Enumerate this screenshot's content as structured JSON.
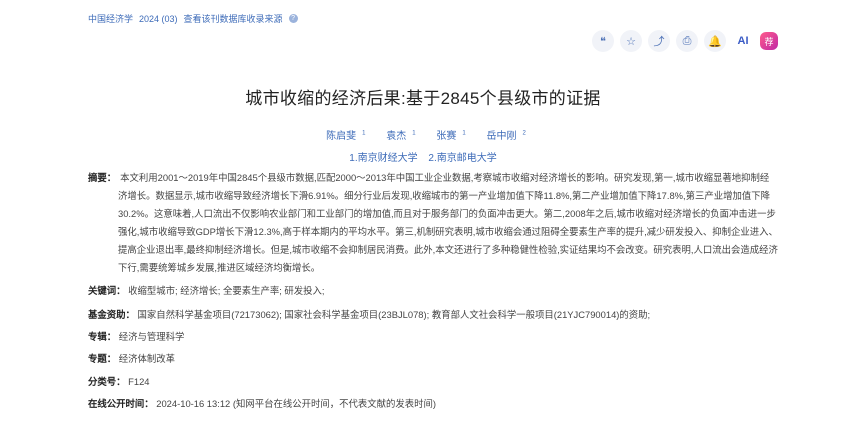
{
  "source": {
    "journal": "中国经济学",
    "issue": "2024 (03)",
    "db_link": "查看该刊数据库收录来源"
  },
  "toolbar": {
    "quote_icon": "quote-icon",
    "star_icon": "star-icon",
    "share_icon": "share-icon",
    "print_icon": "print-icon",
    "bell_icon": "bell-icon",
    "ai_label": "AI",
    "rec_label": "荐"
  },
  "title": "城市收缩的经济后果:基于2845个县级市的证据",
  "authors": [
    {
      "name": "陈启斐",
      "sup": "1"
    },
    {
      "name": "袁杰",
      "sup": "1"
    },
    {
      "name": "张赛",
      "sup": "1"
    },
    {
      "name": "岳中刚",
      "sup": "2"
    }
  ],
  "affiliations": [
    "1.南京财经大学",
    "2.南京邮电大学"
  ],
  "abstract": {
    "label": "摘要：",
    "text": "本文利用2001～2019年中国2845个县级市数据,匹配2000～2013年中国工业企业数据,考察城市收缩对经济增长的影响。研究发现,第一,城市收缩显著地抑制经济增长。数据显示,城市收缩导致经济增长下滑6.91%。细分行业后发现,收缩城市的第一产业增加值下降11.8%,第二产业增加值下降17.8%,第三产业增加值下降30.2%。这意味着,人口流出不仅影响农业部门和工业部门的增加值,而且对于服务部门的负面冲击更大。第二,2008年之后,城市收缩对经济增长的负面冲击进一步强化,城市收缩导致GDP增长下滑12.3%,高于样本期内的平均水平。第三,机制研究表明,城市收缩会通过阻碍全要素生产率的提升,减少研发投入、抑制企业进入、提高企业退出率,最终抑制经济增长。但是,城市收缩不会抑制居民消费。此外,本文还进行了多种稳健性检验,实证结果均不会改变。研究表明,人口流出会造成经济下行,需要统筹城乡发展,推进区域经济均衡增长。"
  },
  "keywords": {
    "label": "关键词：",
    "items": [
      "收缩型城市;",
      "经济增长;",
      "全要素生产率;",
      "研发投入;"
    ]
  },
  "funding": {
    "label": "基金资助：",
    "items": [
      "国家自然科学基金项目(72173062);",
      "国家社会科学基金项目(23BJL078);",
      "教育部人文社会科学一般项目(21YJC790014)的资助;"
    ]
  },
  "column": {
    "label": "专辑：",
    "value": "经济与管理科学"
  },
  "topic": {
    "label": "专题：",
    "value": "经济体制改革"
  },
  "class_no": {
    "label": "分类号：",
    "value": "F124"
  },
  "published": {
    "label": "在线公开时间：",
    "value": "2024-10-16 13:12  (知网平台在线公开时间，不代表文献的发表时间)"
  }
}
